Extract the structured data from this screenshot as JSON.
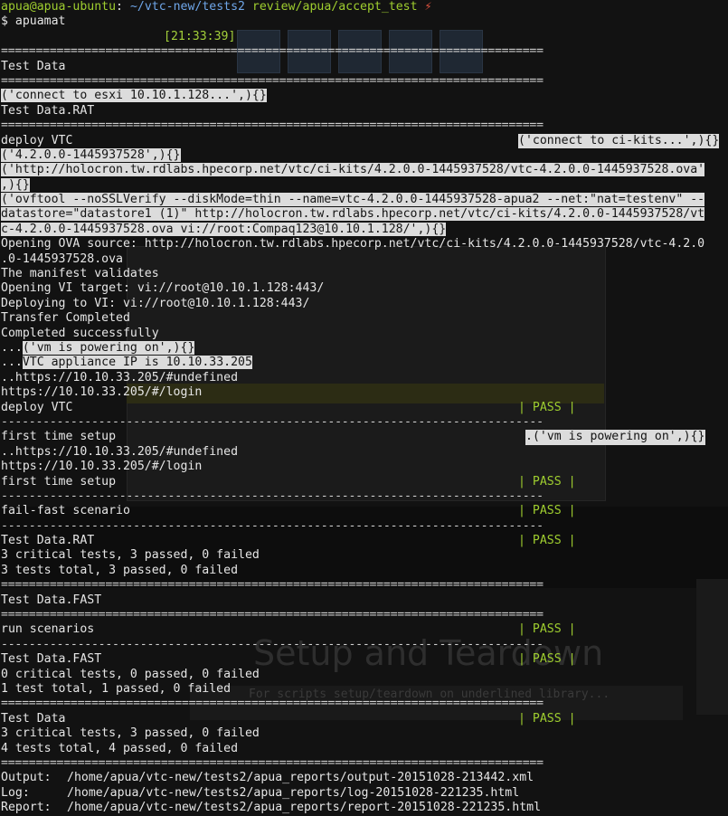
{
  "prompt": {
    "user_host": "apua@apua-ubuntu",
    "sep": ": ",
    "path": "~/vtc-new/tests2",
    "branch": " review/apua/accept_test ",
    "dirty_mark": "⚡",
    "command_line": "$ apuamat"
  },
  "clock": "[21:33:39]",
  "lines": {
    "test_data": "Test Data",
    "connect_esxi": "('connect to esxi 10.10.1.128...',){}",
    "test_data_rat": "Test Data.RAT",
    "deploy_vtc": "deploy VTC",
    "connect_ci": "('connect to ci-kits...',){}",
    "build_tuple": "('4.2.0.0-1445937528',){}",
    "ova_url_1": "('http://holocron.tw.rdlabs.hpecorp.net/vtc/ci-kits/4.2.0.0-1445937528/vtc-4.2.0.0-1445937528.ova'",
    "ova_url_2": ",){}",
    "ovftool_1": "('ovftool --noSSLVerify --diskMode=thin --name=vtc-4.2.0.0-1445937528-apua2 --net:\"nat=testenv\" --",
    "ovftool_2": "datastore=\"datastore1 (1)\" http://holocron.tw.rdlabs.hpecorp.net/vtc/ci-kits/4.2.0.0-1445937528/vt",
    "ovftool_3": "c-4.2.0.0-1445937528.ova vi://root:Compaq123@10.10.1.128/',){}",
    "opening_ova_1": "Opening OVA source: http://holocron.tw.rdlabs.hpecorp.net/vtc/ci-kits/4.2.0.0-1445937528/vtc-4.2.0",
    "opening_ova_2": ".0-1445937528.ova",
    "manifest": "The manifest validates",
    "opening_vi": "Opening VI target: vi://root@10.10.1.128:443/",
    "deploying_vi": "Deploying to VI: vi://root@10.10.1.128:443/",
    "transfer_done": "Transfer Completed",
    "completed_ok": "Completed successfully",
    "dots": "...",
    "vm_powering": "('vm is powering on',){}",
    "vtc_ip": "VTC appliance IP is 10.10.33.205",
    "undefined_1": "..https://10.10.33.205/#undefined",
    "login_1": "https://10.10.33.205/#/login",
    "deploy_vtc_result": "deploy VTC",
    "first_time_setup": "first time setup",
    "vm_powering_2": ".('vm is powering on',){}",
    "undefined_2": "..https://10.10.33.205/#undefined",
    "login_2": "https://10.10.33.205/#/login",
    "first_time_setup_result": "first time setup",
    "fail_fast": "fail-fast scenario",
    "test_data_rat_result": "Test Data.RAT",
    "rat_critical": "3 critical tests, 3 passed, 0 failed",
    "rat_total": "3 tests total, 3 passed, 0 failed",
    "test_data_fast": "Test Data.FAST",
    "run_scenarios": "run scenarios",
    "test_data_fast_result": "Test Data.FAST",
    "fast_critical": "0 critical tests, 0 passed, 0 failed",
    "fast_total": "1 test total, 1 passed, 0 failed",
    "test_data_result": "Test Data",
    "all_critical": "3 critical tests, 3 passed, 0 failed",
    "all_total": "4 tests total, 4 passed, 0 failed"
  },
  "pass_label": "| PASS |",
  "rules": {
    "double": "==============================================================================",
    "single": "------------------------------------------------------------------------------"
  },
  "reports": {
    "output_label": "Output:",
    "output_path": "/home/apua/vtc-new/tests2/apua_reports/output-20151028-213442.xml",
    "log_label": "Log:",
    "log_path": "/home/apua/vtc-new/tests2/apua_reports/log-20151028-221235.html",
    "report_label": "Report:",
    "report_path": "/home/apua/vtc-new/tests2/apua_reports/report-20151028-221235.html"
  },
  "background": {
    "heading": "Setup and Teardown",
    "caption": "For scripts setup/teardown on underlined library..."
  },
  "colors": {
    "bg": "#121212",
    "text": "#e6e6e6",
    "green": "#9fce2f",
    "blue": "#6fa6e8",
    "highlight": "#dcdcdc"
  }
}
